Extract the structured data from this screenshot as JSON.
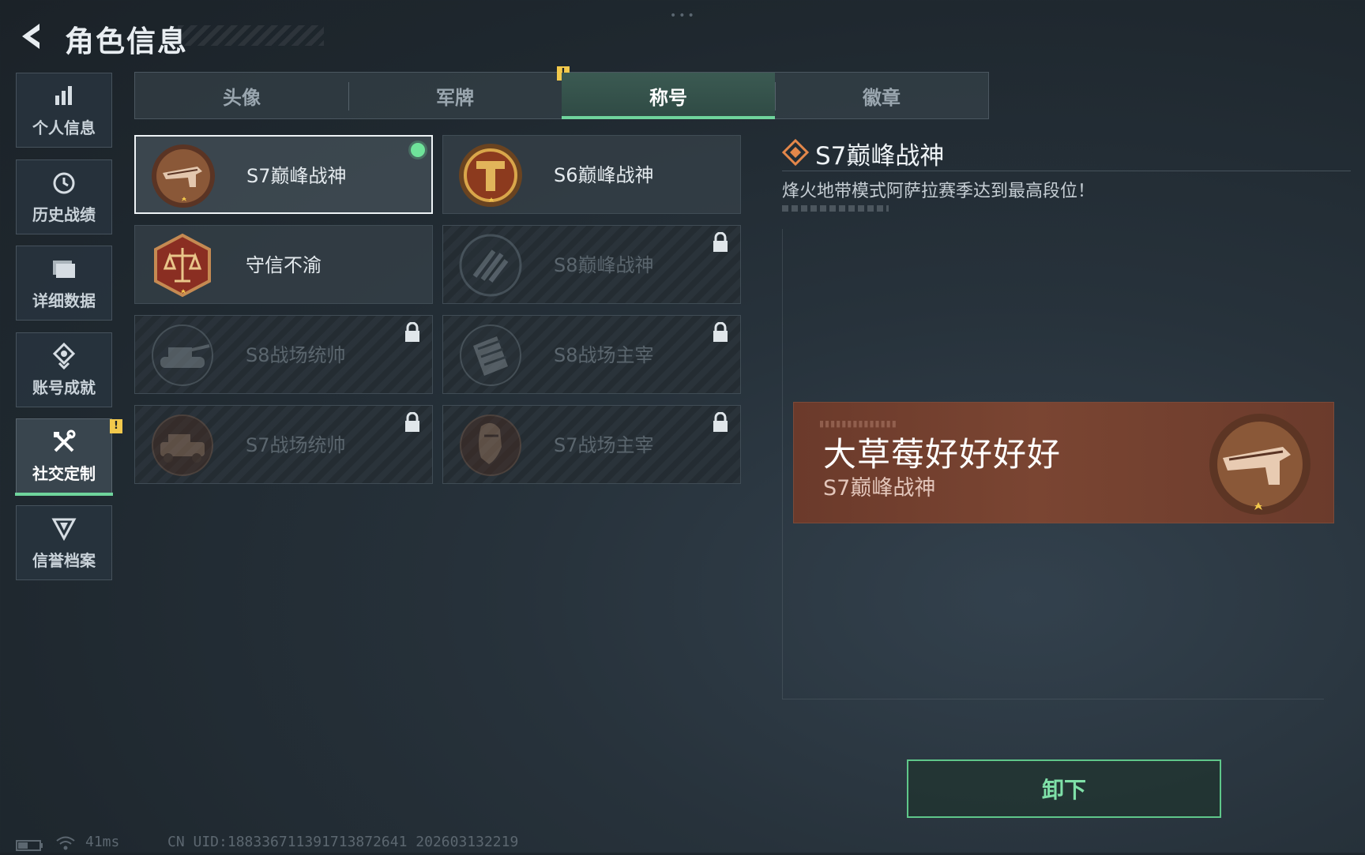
{
  "header": {
    "title": "角色信息"
  },
  "sidebar": {
    "items": [
      {
        "label": "个人信息",
        "icon": "bar-chart-icon"
      },
      {
        "label": "历史战绩",
        "icon": "clock-icon"
      },
      {
        "label": "详细数据",
        "icon": "folder-icon"
      },
      {
        "label": "账号成就",
        "icon": "medal-icon"
      },
      {
        "label": "社交定制",
        "icon": "tools-icon",
        "active": true,
        "badge": "!"
      },
      {
        "label": "信誉档案",
        "icon": "shield-icon"
      }
    ]
  },
  "tabs": [
    {
      "label": "头像"
    },
    {
      "label": "军牌",
      "badge": "!"
    },
    {
      "label": "称号",
      "active": true
    },
    {
      "label": "徽章"
    }
  ],
  "titles": [
    {
      "label": "S7巅峰战神",
      "emblem": "gun-emblem",
      "selected": true,
      "equipped": true,
      "locked": false
    },
    {
      "label": "S6巅峰战神",
      "emblem": "t-shield-emblem",
      "selected": false,
      "equipped": false,
      "locked": false
    },
    {
      "label": "守信不渝",
      "emblem": "scales-emblem",
      "selected": false,
      "equipped": false,
      "locked": false
    },
    {
      "label": "S8巅峰战神",
      "emblem": "stripes-emblem",
      "selected": false,
      "equipped": false,
      "locked": true
    },
    {
      "label": "S8战场统帅",
      "emblem": "tank-emblem",
      "selected": false,
      "equipped": false,
      "locked": true
    },
    {
      "label": "S8战场主宰",
      "emblem": "building-emblem",
      "selected": false,
      "equipped": false,
      "locked": true
    },
    {
      "label": "S7战场统帅",
      "emblem": "vehicle-emblem",
      "selected": false,
      "equipped": false,
      "locked": true
    },
    {
      "label": "S7战场主宰",
      "emblem": "soldier-emblem",
      "selected": false,
      "equipped": false,
      "locked": true
    }
  ],
  "detail": {
    "title": "S7巅峰战神",
    "description": "烽火地带模式阿萨拉赛季达到最高段位！"
  },
  "nameplate": {
    "player_name": "大草莓好好好好",
    "title": "S7巅峰战神"
  },
  "actions": {
    "unequip_label": "卸下"
  },
  "status": {
    "ping": "41ms",
    "uid": "CN UID:188336711391713872641 202603132219"
  },
  "colors": {
    "accent_green": "#6fd49c",
    "badge_yellow": "#f2c94c",
    "nameplate_brown": "#6b3a2b",
    "emblem_bronze": "#a86a3e"
  }
}
